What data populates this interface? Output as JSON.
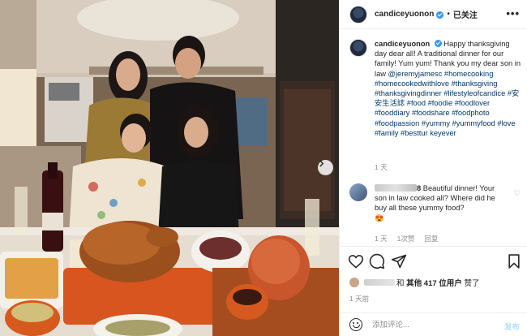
{
  "header": {
    "username": "candiceyuonon",
    "separator": "•",
    "follow_label": "已关注",
    "more_label": "•••"
  },
  "caption": {
    "username": "candiceyuonon",
    "text_part1": "Happy thanksgiving day dear all! A traditional dinner for our family! Yum yum! Thank you my dear son in law ",
    "mention": "@jeremyjamesc",
    "hashtags": "#homecooking #homecookedwithlove #thanksgiving #thanksgivingdinner #lifestyleofcandice #安安生活誌 #food #foodie #foodlover #fooddiary #foodshare #foodphoto #foodpassion #yummy #yummyfood #love #family #besttur keyever",
    "time": "1 天"
  },
  "comment": {
    "name_suffix": "8",
    "text": "Beautiful dinner! Your son in law cooked all? Where did he buy all these yummy food?",
    "emoji": "😍",
    "time": "1 天",
    "likes": "1次赞",
    "reply_label": "回复"
  },
  "likes": {
    "text_prefix": "和",
    "count_text": "其他 417 位用户",
    "text_suffix": "赞了"
  },
  "post_time": "1 天前",
  "add_comment": {
    "placeholder": "添加评论...",
    "post_label": "发布"
  },
  "icons": [
    "verified-badge-icon",
    "more-options-icon",
    "heart-icon",
    "comment-icon",
    "share-icon",
    "bookmark-icon",
    "emoji-icon",
    "next-arrow-icon"
  ],
  "colors": {
    "link": "#00376b",
    "verified": "#3897f0",
    "muted": "#8e8e8e",
    "post_button": "#b2dffc"
  }
}
